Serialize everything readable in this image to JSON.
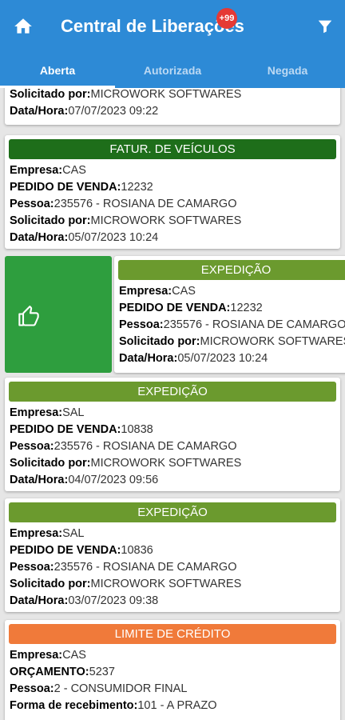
{
  "appbar": {
    "title": "Central de Liberações",
    "badge": "+99",
    "home_icon": "home-icon",
    "filter_icon": "filter-icon",
    "color": "#2d8ad6"
  },
  "tabs": [
    {
      "label": "Aberta"
    },
    {
      "label": "Autorizada"
    },
    {
      "label": "Negada"
    }
  ],
  "partial_card": {
    "rows": [
      {
        "label": "Solicitado por:",
        "value": "MICROWORK SOFTWARES"
      },
      {
        "label": "Data/Hora:",
        "value": "07/07/2023 09:22"
      }
    ]
  },
  "cards": [
    {
      "header": "FATUR. DE VEÍCULOS",
      "color": "#1e6e1a",
      "rows": [
        {
          "label": "Empresa:",
          "value": "CAS"
        },
        {
          "label": "PEDIDO DE VENDA:",
          "value": "12232"
        },
        {
          "label": "Pessoa:",
          "value": "235576 - ROSIANA DE CAMARGO"
        },
        {
          "label": "Solicitado por:",
          "value": "MICROWORK SOFTWARES"
        },
        {
          "label": "Data/Hora:",
          "value": "05/07/2023 10:24"
        }
      ]
    },
    {
      "header": "EXPEDIÇÃO",
      "color": "#6b9a2e",
      "rows": [
        {
          "label": "Empresa:",
          "value": "CAS"
        },
        {
          "label": "PEDIDO DE VENDA:",
          "value": "12232"
        },
        {
          "label": "Pessoa:",
          "value": "235576 - ROSIANA DE CAMARGO"
        },
        {
          "label": "Solicitado por:",
          "value": "MICROWORK SOFTWARES"
        },
        {
          "label": "Data/Hora:",
          "value": "05/07/2023 10:24"
        }
      ]
    },
    {
      "header": "EXPEDIÇÃO",
      "color": "#6b9a2e",
      "rows": [
        {
          "label": "Empresa:",
          "value": "SAL"
        },
        {
          "label": "PEDIDO DE VENDA:",
          "value": "10838"
        },
        {
          "label": "Pessoa:",
          "value": "235576 - ROSIANA DE CAMARGO"
        },
        {
          "label": "Solicitado por:",
          "value": "MICROWORK SOFTWARES"
        },
        {
          "label": "Data/Hora:",
          "value": "04/07/2023 09:56"
        }
      ]
    },
    {
      "header": "EXPEDIÇÃO",
      "color": "#6b9a2e",
      "rows": [
        {
          "label": "Empresa:",
          "value": "SAL"
        },
        {
          "label": "PEDIDO DE VENDA:",
          "value": "10836"
        },
        {
          "label": "Pessoa:",
          "value": "235576 - ROSIANA DE CAMARGO"
        },
        {
          "label": "Solicitado por:",
          "value": "MICROWORK SOFTWARES"
        },
        {
          "label": "Data/Hora:",
          "value": "03/07/2023 09:38"
        }
      ]
    },
    {
      "header": "LIMITE DE CRÉDITO",
      "color": "#f07a3a",
      "rows": [
        {
          "label": "Empresa:",
          "value": "CAS"
        },
        {
          "label": "ORÇAMENTO:",
          "value": "5237"
        },
        {
          "label": "Pessoa:",
          "value": "2 - CONSUMIDOR FINAL"
        },
        {
          "label": "Forma de recebimento:",
          "value": "101 - A PRAZO"
        }
      ]
    }
  ],
  "swipe_action": {
    "icon": "thumbs-up-icon",
    "color": "#2e9e3e"
  }
}
